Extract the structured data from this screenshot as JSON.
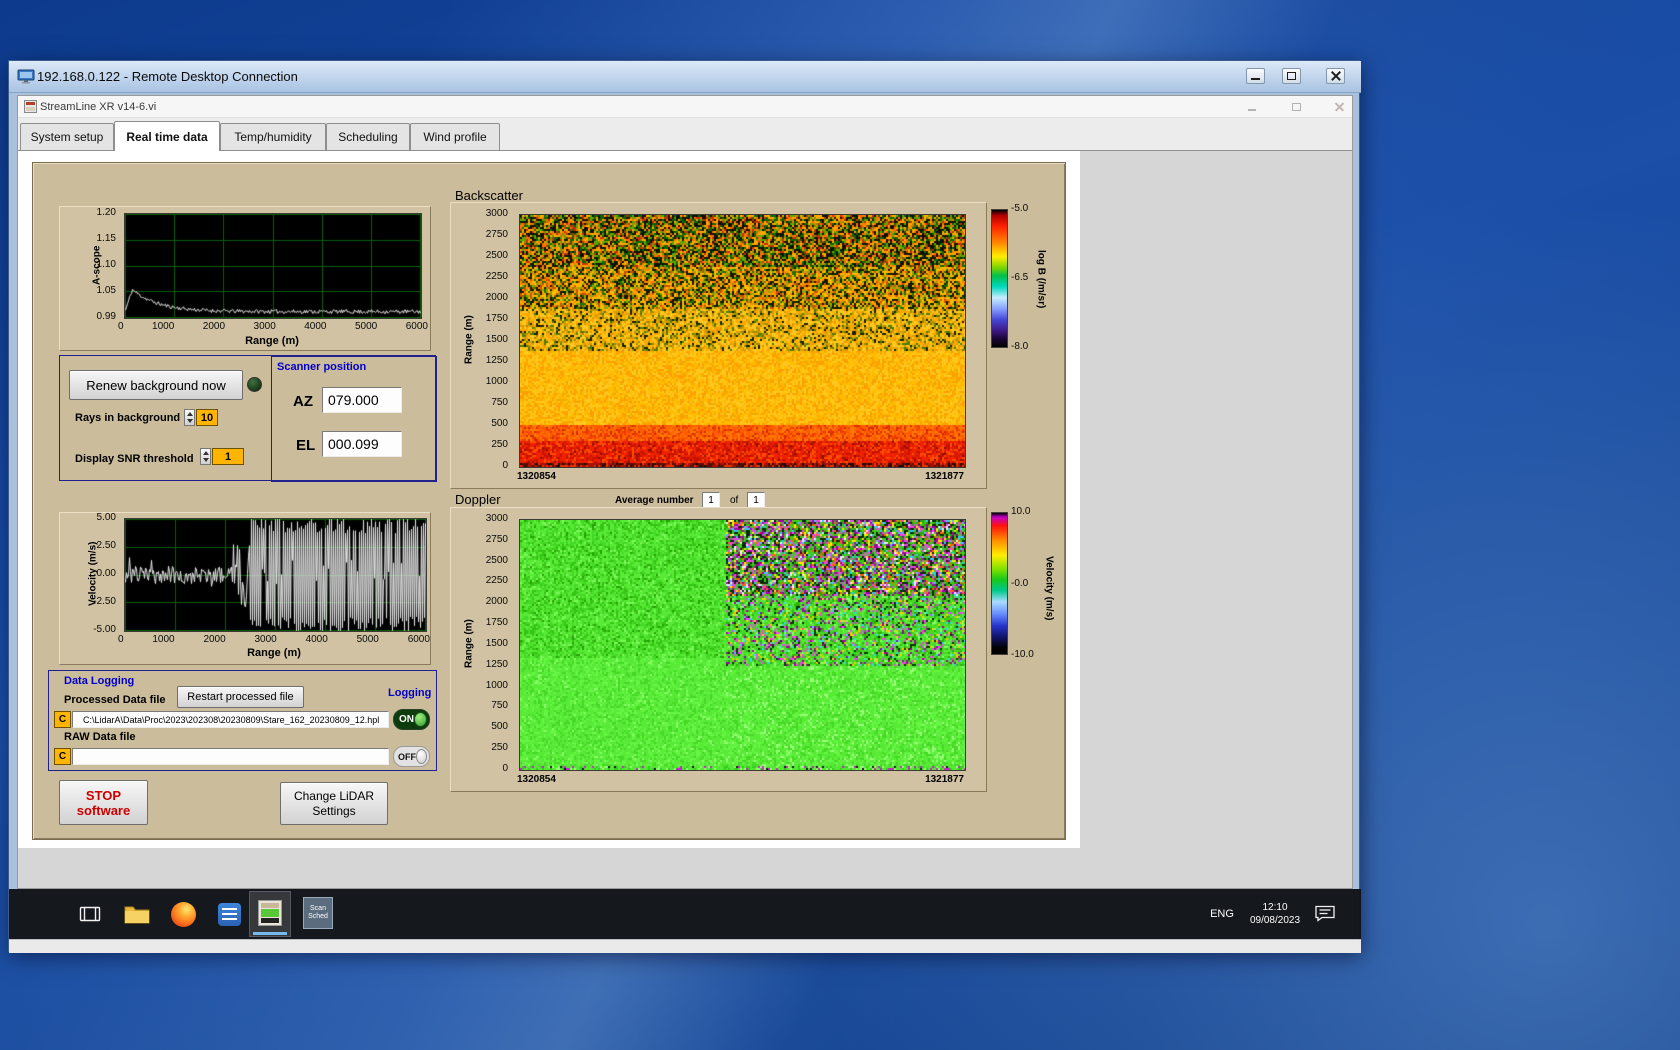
{
  "rdp": {
    "title": "192.168.0.122 - Remote Desktop Connection"
  },
  "app": {
    "title": "StreamLine XR v14-6.vi",
    "tabs": [
      "System setup",
      "Real time data",
      "Temp/humidity",
      "Scheduling",
      "Wind profile"
    ],
    "active_tab": "Real time data"
  },
  "controls": {
    "renew_button": "Renew background now",
    "rays_label": "Rays in background",
    "rays_value": "10",
    "snr_label": "Display SNR threshold",
    "snr_value": "1"
  },
  "scanner": {
    "title": "Scanner position",
    "az_label": "AZ",
    "az_value": "079.000",
    "el_label": "EL",
    "el_value": "000.099"
  },
  "sections": {
    "backscatter_title": "Backscatter",
    "doppler_title": "Doppler",
    "avg_label": "Average number",
    "avg_value": "1",
    "of_label": "of",
    "avg_total": "1"
  },
  "logging": {
    "title": "Data Logging",
    "processed_label": "Processed Data file",
    "restart_button": "Restart processed file",
    "logging_label": "Logging",
    "drive": "C",
    "processed_path": "C:\\LidarA\\Data\\Proc\\2023\\202308\\20230809\\Stare_162_20230809_12.hpl",
    "raw_label": "RAW Data file",
    "raw_path": "",
    "on_label": "ON",
    "off_label": "OFF"
  },
  "actions": {
    "stop_line1": "STOP",
    "stop_line2": "software",
    "change_line1": "Change LiDAR",
    "change_line2": "Settings"
  },
  "taskbar": {
    "language": "ENG",
    "time": "12:10",
    "date": "09/08/2023",
    "scan_line1": "Scan",
    "scan_line2": "Sched"
  },
  "icons": {
    "rdp_titlebar": [
      "computer-icon"
    ],
    "window_controls": [
      "minimize-icon",
      "maximize-icon",
      "close-icon"
    ],
    "taskbar": [
      "task-view-icon",
      "file-explorer-icon",
      "firefox-icon",
      "document-app-icon",
      "streamline-app-icon",
      "scan-scheduler-icon",
      "action-center-icon"
    ]
  },
  "chart_data": [
    {
      "id": "ascope",
      "type": "line",
      "ylabel": "A-scope",
      "xlabel": "Range (m)",
      "xlim": [
        0,
        6000
      ],
      "ylim": [
        0.99,
        1.2
      ],
      "xticks": [
        "0",
        "1000",
        "2000",
        "3000",
        "4000",
        "5000",
        "6000"
      ],
      "yticks": [
        "1.20",
        "1.15",
        "1.10",
        "1.05",
        "0.99"
      ],
      "grid": true,
      "grid_color": "#0b5c0b",
      "bg": "#000000",
      "line_color": "#e8e8e8",
      "profile": {
        "kind": "decay",
        "seed": 11,
        "start": 1.005,
        "peak": 1.047,
        "peak_x": 140,
        "tau": 520,
        "base": 1.002,
        "noise": 0.004
      },
      "description": "A-scope amplitude vs range: sharp peak ~1.047 near 140 m decaying to flat baseline ~1.00 with small noise out to 6000 m"
    },
    {
      "id": "backscatter",
      "type": "heatmap",
      "title": "Backscatter",
      "ylabel": "Range (m)",
      "ylim": [
        0,
        3000
      ],
      "x_start": "1320854",
      "x_end": "1321877",
      "yticks": [
        "3000",
        "2750",
        "2500",
        "2250",
        "2000",
        "1750",
        "1500",
        "1250",
        "1000",
        "750",
        "500",
        "250",
        "0"
      ],
      "colorbar": {
        "label": "log B (/m/sr)",
        "ticks": [
          "-5.0",
          "-6.5",
          "-8.0"
        ],
        "gradient": [
          [
            "#000000",
            0
          ],
          [
            "#b00000",
            4
          ],
          [
            "#ff2200",
            12
          ],
          [
            "#ff8800",
            24
          ],
          [
            "#ffee00",
            34
          ],
          [
            "#7fd400",
            42
          ],
          [
            "#00c04a",
            48
          ],
          [
            "#00d8c0",
            56
          ],
          [
            "#c8ecff",
            64
          ],
          [
            "#86a2ff",
            72
          ],
          [
            "#4646d8",
            80
          ],
          [
            "#3c1a86",
            88
          ],
          [
            "#1a0436",
            94
          ],
          [
            "#000000",
            100
          ]
        ]
      },
      "seed": 3,
      "bands": [
        {
          "y0": 0,
          "y1": 70,
          "colors": [
            [
              "#5a0e00",
              0.3
            ],
            [
              "#a81200",
              0.3
            ],
            [
              "#1e0a00",
              0.2
            ],
            [
              "#e83300",
              0.2
            ]
          ]
        },
        {
          "y0": 70,
          "y1": 330,
          "colors": [
            [
              "#ee2200",
              0.45
            ],
            [
              "#c81200",
              0.3
            ],
            [
              "#ff4d00",
              0.2
            ],
            [
              "#8c0e00",
              0.05
            ]
          ]
        },
        {
          "y0": 330,
          "y1": 520,
          "colors": [
            [
              "#ff5a00",
              0.4
            ],
            [
              "#ff7a00",
              0.3
            ],
            [
              "#ee3c00",
              0.2
            ],
            [
              "#d42a00",
              0.1
            ]
          ]
        },
        {
          "y0": 520,
          "y1": 1400,
          "colors": [
            [
              "#ffbb00",
              0.38
            ],
            [
              "#ffc81e",
              0.3
            ],
            [
              "#ff9e00",
              0.22
            ],
            [
              "#eeae00",
              0.1
            ]
          ]
        },
        {
          "y0": 1400,
          "y1": 1900,
          "colors": [
            [
              "#ffc81e",
              0.34
            ],
            [
              "#ffa800",
              0.24
            ],
            [
              "#d89c00",
              0.14
            ],
            [
              "#a08c00",
              0.1
            ],
            [
              "#4e7a00",
              0.08
            ],
            [
              "#142000",
              0.1
            ]
          ]
        },
        {
          "y0": 1900,
          "y1": 2400,
          "colors": [
            [
              "#ffba00",
              0.26
            ],
            [
              "#ff8800",
              0.18
            ],
            [
              "#c85200",
              0.1
            ],
            [
              "#8ea600",
              0.12
            ],
            [
              "#1e7000",
              0.12
            ],
            [
              "#101800",
              0.22
            ]
          ]
        },
        {
          "y0": 2400,
          "y1": 3000,
          "colors": [
            [
              "#ffa800",
              0.2
            ],
            [
              "#ff7300",
              0.13
            ],
            [
              "#c83000",
              0.09
            ],
            [
              "#62a400",
              0.14
            ],
            [
              "#0e6400",
              0.16
            ],
            [
              "#0c120a",
              0.28
            ]
          ]
        }
      ],
      "description": "Time-height backscatter: strong red returns below ~300 m, solid yellow-orange 500-1500 m, increasingly speckled yellow/green/black above 1500 m"
    },
    {
      "id": "velocity",
      "type": "line",
      "ylabel": "Velocity (m/s)",
      "xlabel": "Range (m)",
      "xlim": [
        0,
        6000
      ],
      "ylim": [
        -5,
        5
      ],
      "xticks": [
        "0",
        "1000",
        "2000",
        "3000",
        "4000",
        "5000",
        "6000"
      ],
      "yticks": [
        "5.00",
        "2.50",
        "0.00",
        "-2.50",
        "-5.00"
      ],
      "grid": true,
      "grid_color": "#0b5c0b",
      "bg": "#000000",
      "line_color": "#e8e8e8",
      "profile": {
        "kind": "burst",
        "seed": 23,
        "quiet_until": 2150,
        "quiet_amp": 0.8,
        "trans_until": 2500,
        "trans_amp": 3.0,
        "full_amp": 5.0
      },
      "description": "Radial velocity vs range: small fluctuation around 0 m/s out to ~2200 m, then uncorrelated noise saturating the full ±5 m/s scale to 6000 m"
    },
    {
      "id": "doppler",
      "type": "heatmap",
      "title": "Doppler",
      "ylabel": "Range (m)",
      "ylim": [
        0,
        3000
      ],
      "x_start": "1320854",
      "x_end": "1321877",
      "yticks": [
        "3000",
        "2750",
        "2500",
        "2250",
        "2000",
        "1750",
        "1500",
        "1250",
        "1000",
        "750",
        "500",
        "250",
        "0"
      ],
      "colorbar": {
        "label": "Velocity (m/s)",
        "ticks": [
          "10.0",
          "-0.0",
          "-10.0"
        ],
        "gradient": [
          [
            "#000000",
            0
          ],
          [
            "#c400c4",
            3
          ],
          [
            "#ff1010",
            9
          ],
          [
            "#ff8800",
            19
          ],
          [
            "#ffee00",
            30
          ],
          [
            "#7fe000",
            40
          ],
          [
            "#19c819",
            47
          ],
          [
            "#00c88c",
            55
          ],
          [
            "#aadcff",
            63
          ],
          [
            "#6488ff",
            72
          ],
          [
            "#2634cc",
            80
          ],
          [
            "#101468",
            88
          ],
          [
            "#000000",
            96
          ],
          [
            "#000000",
            100
          ]
        ]
      },
      "seed": 7,
      "x_split": 0.46,
      "bands": [
        {
          "y0": 0,
          "y1": 60,
          "colors": [
            [
              "#55e833",
              0.5
            ],
            [
              "#33cc22",
              0.18
            ],
            [
              "#c822c8",
              0.1
            ],
            [
              "#141414",
              0.07
            ],
            [
              "#99ff77",
              0.15
            ]
          ]
        },
        {
          "y0": 60,
          "y1": 1350,
          "colors": [
            [
              "#58ea36",
              0.5
            ],
            [
              "#66f544",
              0.25
            ],
            [
              "#46d826",
              0.2
            ],
            [
              "#88ff66",
              0.05
            ]
          ]
        },
        {
          "y0": 1350,
          "y1": 3000,
          "colors": [
            [
              "#58ea36",
              0.4
            ],
            [
              "#46d826",
              0.25
            ],
            [
              "#36c414",
              0.2
            ],
            [
              "#79f858",
              0.1
            ],
            [
              "#24a404",
              0.05
            ]
          ]
        }
      ],
      "bands_right": [
        {
          "y0": 0,
          "y1": 60,
          "colors": [
            [
              "#55e833",
              0.5
            ],
            [
              "#33cc22",
              0.18
            ],
            [
              "#c822c8",
              0.1
            ],
            [
              "#141414",
              0.07
            ],
            [
              "#99ff77",
              0.15
            ]
          ]
        },
        {
          "y0": 60,
          "y1": 1250,
          "colors": [
            [
              "#58ea36",
              0.45
            ],
            [
              "#66f544",
              0.25
            ],
            [
              "#46d826",
              0.2
            ],
            [
              "#99ff77",
              0.1
            ]
          ]
        },
        {
          "y0": 1250,
          "y1": 2100,
          "colors": [
            [
              "#46d826",
              0.3
            ],
            [
              "#58ea36",
              0.2
            ],
            [
              "#2cb40c",
              0.12
            ],
            [
              "#88ff66",
              0.08
            ],
            [
              "#ee44ee",
              0.07
            ],
            [
              "#a400a4",
              0.06
            ],
            [
              "#ffcc00",
              0.05
            ],
            [
              "#36d8ff",
              0.04
            ],
            [
              "#0a3200",
              0.08
            ]
          ]
        },
        {
          "y0": 2100,
          "y1": 3000,
          "colors": [
            [
              "#3ecc1e",
              0.22
            ],
            [
              "#28a808",
              0.12
            ],
            [
              "#ee44ee",
              0.13
            ],
            [
              "#a400a4",
              0.1
            ],
            [
              "#ffee00",
              0.08
            ],
            [
              "#ff6600",
              0.06
            ],
            [
              "#38c8ff",
              0.06
            ],
            [
              "#eeeeff",
              0.05
            ],
            [
              "#082800",
              0.18
            ]
          ]
        }
      ],
      "description": "Doppler velocity time-height: near-zero (green) everywhere; right portion above ~1300 m speckled with magenta/yellow/blue noise"
    }
  ]
}
